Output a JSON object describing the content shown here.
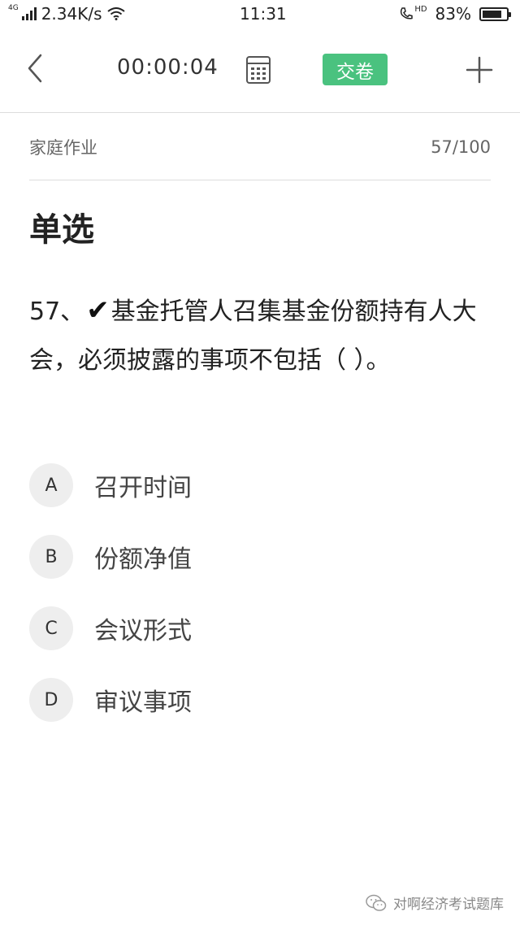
{
  "status_bar": {
    "network_type": "4G",
    "speed": "2.34K/s",
    "time": "11:31",
    "hd_label": "HD",
    "battery_percent": "83%",
    "battery_level": 0.83
  },
  "toolbar": {
    "timer": "00:00:04",
    "submit_label": "交卷",
    "accent_color": "#4ac27f"
  },
  "subheader": {
    "section": "家庭作业",
    "progress": "57/100"
  },
  "question": {
    "type": "单选",
    "number": "57、",
    "mark": "✔",
    "text": "基金托管人召集基金份额持有人大会，必须披露的事项不包括（ ）。"
  },
  "options": [
    {
      "letter": "A",
      "text": "召开时间"
    },
    {
      "letter": "B",
      "text": "份额净值"
    },
    {
      "letter": "C",
      "text": "会议形式"
    },
    {
      "letter": "D",
      "text": "审议事项"
    }
  ],
  "watermark": {
    "text": "对啊经济考试题库"
  }
}
